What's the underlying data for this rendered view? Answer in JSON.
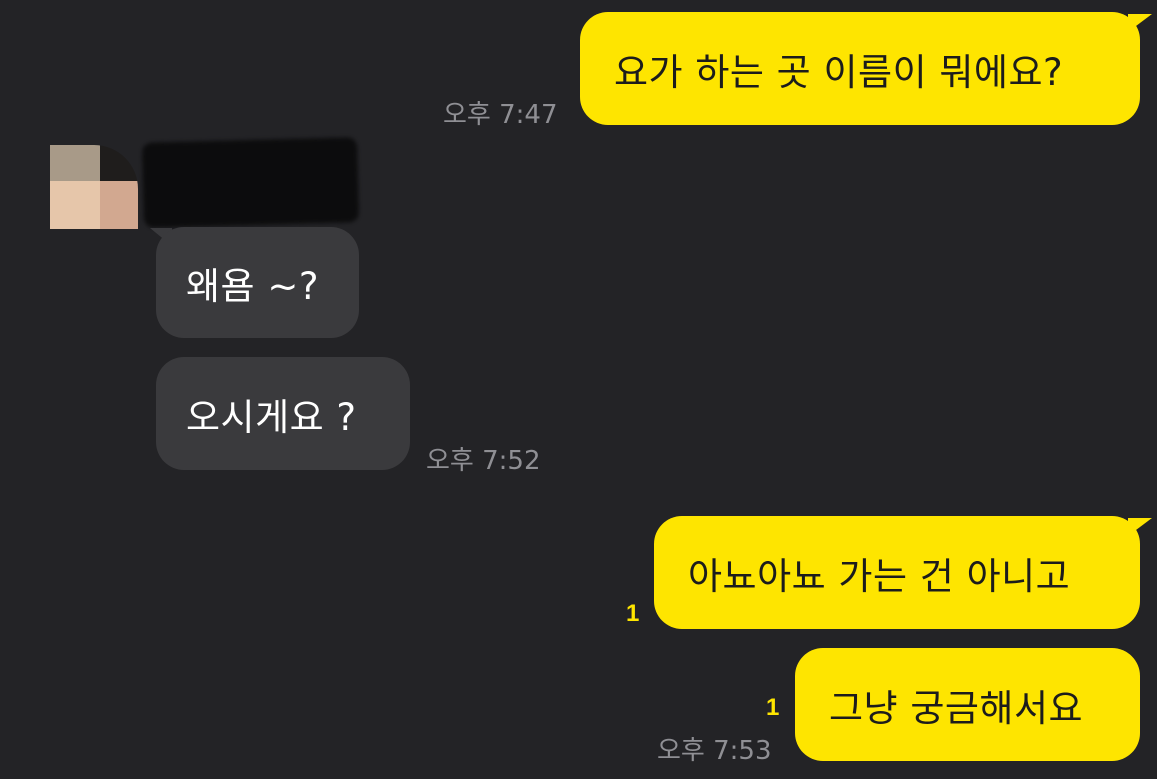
{
  "chat": {
    "messages": [
      {
        "sender": "me",
        "text": "요가 하는 곳 이름이 뭐에요?",
        "time": "오후 7:47"
      },
      {
        "sender": "other",
        "text": "왜욤 ~?"
      },
      {
        "sender": "other",
        "text": "오시게요 ?",
        "time": "오후 7:52"
      },
      {
        "sender": "me",
        "text": "아뇨아뇨 가는 건 아니고",
        "unread": "1"
      },
      {
        "sender": "me",
        "text": "그냥 궁금해서요",
        "unread": "1",
        "time": "오후 7:53"
      }
    ]
  },
  "colors": {
    "background": "#232326",
    "my_bubble": "#FEE500",
    "their_bubble": "#3a3a3d",
    "timestamp": "#8f8f94",
    "unread": "#FEE500"
  }
}
